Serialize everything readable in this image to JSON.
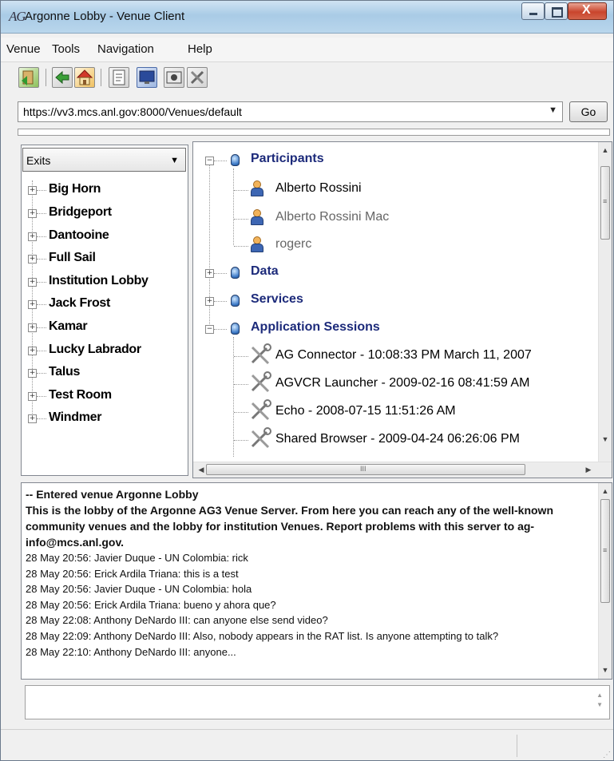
{
  "window": {
    "logo": "AG",
    "title": "Argonne Lobby - Venue Client",
    "controls": {
      "minimize_icon": "minimize-icon",
      "maximize_icon": "maximize-icon",
      "close_label": "X"
    }
  },
  "menu": [
    "Venue",
    "Tools",
    "Navigation",
    "Help"
  ],
  "toolbar": {
    "icons": [
      "enter-venue-icon",
      "back-icon",
      "home-icon",
      "document-icon",
      "monitor-icon",
      "video-icon",
      "tools-icon"
    ]
  },
  "address": {
    "url": "https://vv3.mcs.anl.gov:8000/Venues/default",
    "go_label": "Go"
  },
  "exits": {
    "selected": "Exits",
    "items": [
      "Big Horn",
      "Bridgeport",
      "Dantooine",
      "Full Sail",
      "Institution Lobby",
      "Jack Frost",
      "Kamar",
      "Lucky Labrador",
      "Talus",
      "Test Room",
      "Windmer"
    ]
  },
  "tree": {
    "participants_label": "Participants",
    "participants": [
      "Alberto Rossini",
      "Alberto Rossini Mac",
      "rogerc"
    ],
    "data_label": "Data",
    "services_label": "Services",
    "apps_label": "Application Sessions",
    "apps": [
      "AG Connector - 10:08:33 PM March 11, 2007",
      "AGVCR Launcher - 2009-02-16 08:41:59 AM",
      "Echo - 2008-07-15 11:51:26 AM",
      "Shared Browser - 2009-04-24 06:26:06 PM"
    ],
    "hscroll_grip": "III",
    "vscroll_grip": "≡"
  },
  "chat": {
    "entered": "-- Entered venue Argonne Lobby",
    "description_lines": [
      "This is the lobby of the Argonne AG3 Venue Server.  From here you can reach any of the well-known",
      "community venues and the lobby for institution Venues.  Report problems with this server to ag-",
      "info@mcs.anl.gov."
    ],
    "messages": [
      "28 May 20:56: Javier Duque - UN Colombia: rick",
      "28 May 20:56: Erick Ardila Triana: this is a test",
      "28 May 20:56: Javier Duque - UN Colombia: hola",
      "28 May 20:56: Erick Ardila Triana: bueno y ahora que?",
      "28 May 22:08: Anthony DeNardo III: can anyone else send video?",
      "28 May 22:09: Anthony DeNardo III: Also, nobody appears in the RAT list.  Is anyone attempting to talk?",
      "28 May 22:10: Anthony DeNardo III: anyone..."
    ],
    "input_value": ""
  }
}
